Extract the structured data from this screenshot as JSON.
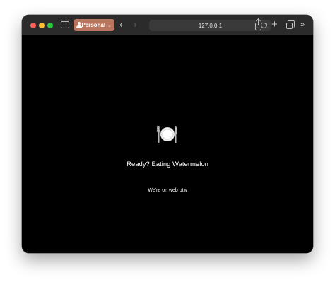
{
  "toolbar": {
    "profile_label": "Personal",
    "url": "127.0.0.1",
    "back_glyph": "‹",
    "forward_glyph": "›",
    "new_tab_glyph": "+",
    "overflow_glyph": "»"
  },
  "colors": {
    "profile_accent": "#b9755d",
    "page_background": "#000000",
    "toolbar_background": "#2b2b2b"
  },
  "icons": [
    "sidebar-icon",
    "person-icon",
    "reload-icon",
    "share-icon",
    "plus-icon",
    "tabs-icon",
    "overflow-icon",
    "fork-knife-plate-icon"
  ],
  "page": {
    "heading": "Ready? Eating Watermelon",
    "subtext": "We're on web btw"
  }
}
